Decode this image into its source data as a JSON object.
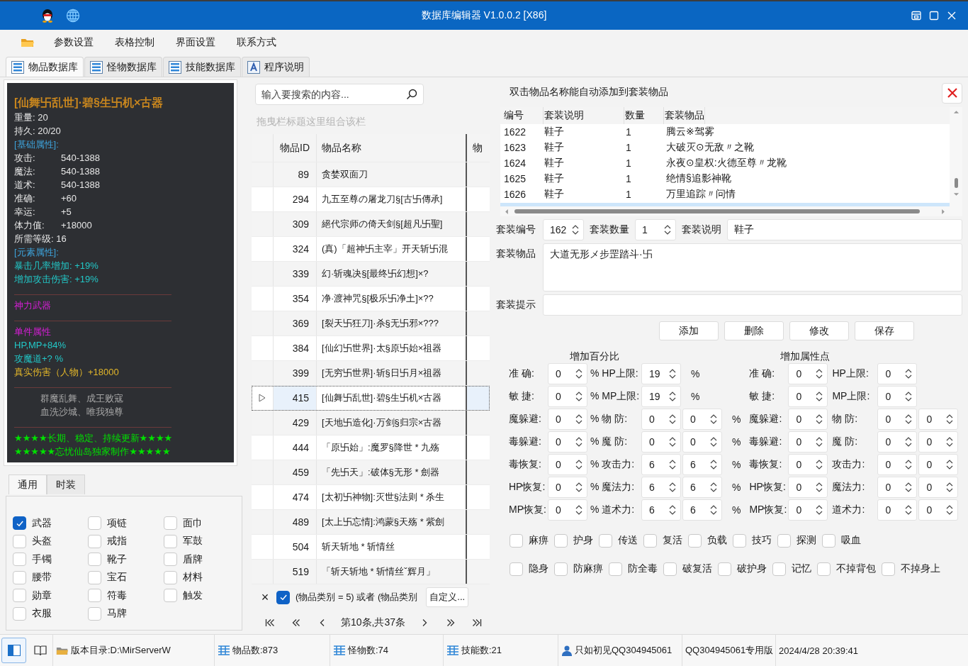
{
  "window": {
    "title": "数据库编辑器 V1.0.0.2 [X86]"
  },
  "menu": [
    "参数设置",
    "表格控制",
    "界面设置",
    "联系方式"
  ],
  "tabs": [
    {
      "label": "物品数据库",
      "kind": "table",
      "selected": true
    },
    {
      "label": "怪物数据库",
      "kind": "table",
      "selected": false
    },
    {
      "label": "技能数据库",
      "kind": "table",
      "selected": false
    },
    {
      "label": "程序说明",
      "kind": "help",
      "selected": false
    }
  ],
  "item_card": {
    "groups": [
      {
        "lines": [
          {
            "kind": "title",
            "text": "[仙舞卐乱世]·碧§生卐机×古器"
          },
          {
            "kind": "normal",
            "text": "重量: 20"
          },
          {
            "kind": "normal",
            "text": "持久: 20/20"
          },
          {
            "kind": "section",
            "text": "[基础属性]:"
          },
          {
            "kind": "normal",
            "text": "攻击:",
            "value": "540-1388"
          },
          {
            "kind": "normal",
            "text": "魔法:",
            "value": "540-1388"
          },
          {
            "kind": "normal",
            "text": "道术:",
            "value": "540-1388"
          },
          {
            "kind": "normal",
            "text": "准确:",
            "value": "+60"
          },
          {
            "kind": "normal",
            "text": "幸运:",
            "value": "+5"
          },
          {
            "kind": "normal",
            "text": "体力值:",
            "value": "+18000"
          },
          {
            "kind": "normal",
            "text": "所需等级: 16"
          },
          {
            "kind": "section",
            "text": "[元素属性]:"
          },
          {
            "kind": "element",
            "text": "暴击几率增加: +19%"
          },
          {
            "kind": "element",
            "text": "增加攻击伤害: +19%"
          }
        ]
      },
      {
        "lines": [
          {
            "kind": "special",
            "text": "神力武器"
          }
        ]
      },
      {
        "lines": [
          {
            "kind": "special",
            "text": "单件属性"
          },
          {
            "kind": "element",
            "text": "HP,MP+84%"
          },
          {
            "kind": "element",
            "text": "攻魔道+? %"
          },
          {
            "kind": "bonus",
            "text": "真实伤害（人物）+18000"
          }
        ]
      },
      {
        "lines": [
          {
            "kind": "motto",
            "text": "群魔乱舞、成王败寇"
          },
          {
            "kind": "motto",
            "text": "血洗沙城、唯我独尊"
          }
        ]
      },
      {
        "lines": [
          {
            "kind": "banner",
            "text": "★★★★长期、稳定、持续更新★★★★"
          },
          {
            "kind": "banner",
            "text": "★★★★★忘忧仙岛独家制作★★★★★"
          }
        ]
      }
    ]
  },
  "category_tabs": [
    {
      "label": "通用",
      "selected": true
    },
    {
      "label": "时装",
      "selected": false
    }
  ],
  "categories": [
    {
      "label": "武器",
      "checked": true
    },
    {
      "label": "项链",
      "checked": false
    },
    {
      "label": "面巾",
      "checked": false
    },
    {
      "label": "头盔",
      "checked": false
    },
    {
      "label": "戒指",
      "checked": false
    },
    {
      "label": "军鼓",
      "checked": false
    },
    {
      "label": "手镯",
      "checked": false
    },
    {
      "label": "靴子",
      "checked": false
    },
    {
      "label": "盾牌",
      "checked": false
    },
    {
      "label": "腰带",
      "checked": false
    },
    {
      "label": "宝石",
      "checked": false
    },
    {
      "label": "材料",
      "checked": false
    },
    {
      "label": "勋章",
      "checked": false
    },
    {
      "label": "符毒",
      "checked": false
    },
    {
      "label": "触发",
      "checked": false
    },
    {
      "label": "衣服",
      "checked": false
    },
    {
      "label": "马牌",
      "checked": false
    }
  ],
  "search": {
    "placeholder": "输入要搜索的内容..."
  },
  "group_hint": "拖曳栏标题这里组合该栏",
  "table": {
    "columns": [
      "物品ID",
      "物品名称",
      "物"
    ],
    "rows": [
      {
        "id": "89",
        "name": "贪婪双面刀",
        "selected": false
      },
      {
        "id": "294",
        "name": "九五至尊の屠龙刀§[古卐傳承]",
        "selected": false
      },
      {
        "id": "309",
        "name": "絕代宗师の倚天剑§[超凡卐聖]",
        "selected": false
      },
      {
        "id": "324",
        "name": "(真)「超神卐主宰」开天斩卐混",
        "selected": false
      },
      {
        "id": "339",
        "name": "幻·斩魂决§[最终卐幻想]×?",
        "selected": false
      },
      {
        "id": "354",
        "name": "净·渡神咒§[极乐卐净土]×??",
        "selected": false
      },
      {
        "id": "369",
        "name": "[裂天卐狂刀]·杀§无卐邪×???",
        "selected": false
      },
      {
        "id": "384",
        "name": "[仙幻卐世界]·太§原卐始×祖器",
        "selected": false
      },
      {
        "id": "399",
        "name": "[无穷卐世界]·斩§日卐月×祖器",
        "selected": false
      },
      {
        "id": "415",
        "name": "[仙舞卐乱世]·碧§生卐机×古器",
        "selected": true
      },
      {
        "id": "429",
        "name": "[天地卐造化]·万剑§归宗×古器",
        "selected": false
      },
      {
        "id": "444",
        "name": "「原卐始」:魔罗§降世 * 九殇",
        "selected": false
      },
      {
        "id": "459",
        "name": "「先卐天」:破体§无形 * 劍器",
        "selected": false
      },
      {
        "id": "474",
        "name": "[太初卐神物]:灭世§法则 * 杀生",
        "selected": false
      },
      {
        "id": "489",
        "name": "[太上卐忘情]:鸿蒙§天殇 * 紫劍",
        "selected": false
      },
      {
        "id": "504",
        "name": "斩天斩地 * 斩情丝",
        "selected": false
      },
      {
        "id": "519",
        "name": "「斩天斩地 * 斩情丝ˇ辉月」",
        "selected": false
      }
    ]
  },
  "filter": {
    "close": "×",
    "checked": true,
    "text": "(物品类别 = 5) 或者 (物品类别",
    "button": "自定义..."
  },
  "pager": {
    "text": "第10条,共37条"
  },
  "suit_panel": {
    "hint": "双击物品名称能自动添加到套装物品",
    "table": {
      "columns": [
        "编号",
        "套装说明",
        "数量",
        "套装物品"
      ],
      "rows": [
        {
          "id": "1622",
          "desc": "鞋子",
          "count": "1",
          "items": "腾云※驾雾",
          "selected": false
        },
        {
          "id": "1623",
          "desc": "鞋子",
          "count": "1",
          "items": "大破灭⊙无敌〃之靴",
          "selected": false
        },
        {
          "id": "1624",
          "desc": "鞋子",
          "count": "1",
          "items": "永夜⊙皇权:火德至尊〃龙靴",
          "selected": false
        },
        {
          "id": "1625",
          "desc": "鞋子",
          "count": "1",
          "items": "绝情§追影神靴",
          "selected": false
        },
        {
          "id": "1626",
          "desc": "鞋子",
          "count": "1",
          "items": "万里追踪〃问情",
          "selected": false
        },
        {
          "selected": true
        }
      ]
    },
    "form": {
      "no_label": "套装编号",
      "no": "162",
      "count_label": "套装数量",
      "count": "1",
      "desc_label": "套装说明",
      "desc": "鞋子",
      "items_label": "套装物品",
      "items": "大道无形メ步罡踏斗·卐",
      "hint_label": "套装提示"
    },
    "buttons": [
      "添加",
      "删除",
      "修改",
      "保存"
    ],
    "percent": {
      "title": "增加百分比",
      "rows": [
        {
          "label": "准 确:",
          "value": "0",
          "label2": "% HP上限:",
          "values": [
            "19"
          ],
          "unit": "%"
        },
        {
          "label": "敏 捷:",
          "value": "0",
          "label2": "% MP上限:",
          "values": [
            "19"
          ],
          "unit": "%"
        },
        {
          "label": "魔躲避:",
          "value": "0",
          "label2": "% 物 防:",
          "values": [
            "0",
            "0"
          ],
          "unit": "%"
        },
        {
          "label": "毒躲避:",
          "value": "0",
          "label2": "% 魔 防:",
          "values": [
            "0",
            "0"
          ],
          "unit": "%"
        },
        {
          "label": "毒恢复:",
          "value": "0",
          "label2": "% 攻击力:",
          "values": [
            "6",
            "6"
          ],
          "unit": "%"
        },
        {
          "label": "HP恢复:",
          "value": "0",
          "label2": "% 魔法力:",
          "values": [
            "6",
            "6"
          ],
          "unit": "%"
        },
        {
          "label": "MP恢复:",
          "value": "0",
          "label2": "% 道术力:",
          "values": [
            "6",
            "6"
          ],
          "unit": "%"
        }
      ]
    },
    "points": {
      "title": "增加属性点",
      "rows": [
        {
          "label": "准 确:",
          "value": "0",
          "label2": "HP上限:",
          "values": [
            "0"
          ]
        },
        {
          "label": "敏 捷:",
          "value": "0",
          "label2": "MP上限:",
          "values": [
            "0"
          ]
        },
        {
          "label": "魔躲避:",
          "value": "0",
          "label2": "物 防:",
          "values": [
            "0",
            "0"
          ]
        },
        {
          "label": "毒躲避:",
          "value": "0",
          "label2": "魔 防:",
          "values": [
            "0",
            "0"
          ]
        },
        {
          "label": "毒恢复:",
          "value": "0",
          "label2": "攻击力:",
          "values": [
            "0",
            "0"
          ]
        },
        {
          "label": "HP恢复:",
          "value": "0",
          "label2": "魔法力:",
          "values": [
            "0",
            "0"
          ]
        },
        {
          "label": "MP恢复:",
          "value": "0",
          "label2": "道术力:",
          "values": [
            "0",
            "0"
          ]
        }
      ]
    },
    "flags": [
      {
        "items": [
          {
            "label": "麻痹",
            "checked": false
          },
          {
            "label": "护身",
            "checked": false
          },
          {
            "label": "传送",
            "checked": false
          },
          {
            "label": "复活",
            "checked": false
          },
          {
            "label": "负载",
            "checked": false
          },
          {
            "label": "技巧",
            "checked": false
          },
          {
            "label": "探测",
            "checked": false
          },
          {
            "label": "吸血",
            "checked": false
          }
        ]
      },
      {
        "items": [
          {
            "label": "隐身",
            "checked": false
          },
          {
            "label": "防麻痹",
            "checked": false
          },
          {
            "label": "防全毒",
            "checked": false
          },
          {
            "label": "破复活",
            "checked": false
          },
          {
            "label": "破护身",
            "checked": false
          },
          {
            "label": "记忆",
            "checked": false
          },
          {
            "label": "不掉背包",
            "checked": false
          },
          {
            "label": "不掉身上",
            "checked": false
          }
        ]
      }
    ]
  },
  "status_bar": {
    "version": "版本目录:D:\\MirServerW",
    "items": "物品数:873",
    "monsters": "怪物数:74",
    "skills": "技能数:21",
    "user": "只如初见QQ304945061",
    "edition": "QQ304945061专用版",
    "time": "2024/4/28 20:39:41"
  }
}
